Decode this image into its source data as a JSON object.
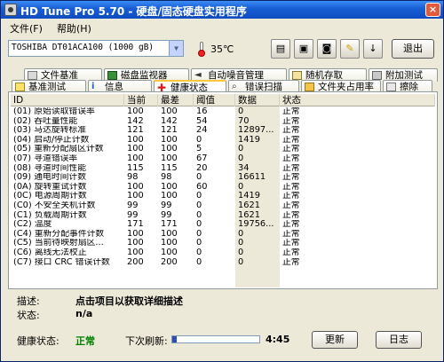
{
  "window": {
    "title": "HD Tune Pro 5.70 - 硬盘/固态硬盘实用程序",
    "close_label": "×"
  },
  "menu": {
    "file": "文件(F)",
    "help": "帮助(H)"
  },
  "toolbar": {
    "drive": "TOSHIBA DT01ACA100 (1000 gB)",
    "temperature": "35℃",
    "exit_label": "退出",
    "buttons": [
      {
        "icon": "copy-info-icon",
        "glyph": "▤"
      },
      {
        "icon": "copy-screen-icon",
        "glyph": "▣"
      },
      {
        "icon": "screenshot-icon",
        "glyph": "◙"
      },
      {
        "icon": "options-icon",
        "glyph": "✎"
      },
      {
        "icon": "download-icon",
        "glyph": "↓"
      }
    ]
  },
  "tabs_top": [
    "文件基准",
    "磁盘监视器",
    "自动噪音管理",
    "随机存取",
    "附加测试"
  ],
  "tabs_bottom": [
    "基准测试",
    "信息",
    "健康状态",
    "错误扫描",
    "文件夹占用率",
    "擦除"
  ],
  "table": {
    "headers": [
      "ID",
      "当前",
      "最差",
      "阈值",
      "数据",
      "状态"
    ],
    "rows": [
      [
        "(01) 原始读取错误率",
        "100",
        "100",
        "16",
        "0",
        "正常"
      ],
      [
        "(02) 吞吐量性能",
        "142",
        "142",
        "54",
        "70",
        "正常"
      ],
      [
        "(03) 马达旋转标准",
        "121",
        "121",
        "24",
        "12897...",
        "正常"
      ],
      [
        "(04) 启动/停止计数",
        "100",
        "100",
        "0",
        "1419",
        "正常"
      ],
      [
        "(05) 重新分配扇区计数",
        "100",
        "100",
        "5",
        "0",
        "正常"
      ],
      [
        "(07) 寻道错误率",
        "100",
        "100",
        "67",
        "0",
        "正常"
      ],
      [
        "(08) 寻道时间性能",
        "115",
        "115",
        "20",
        "34",
        "正常"
      ],
      [
        "(09) 通电时间计数",
        "98",
        "98",
        "0",
        "16611",
        "正常"
      ],
      [
        "(0A) 旋转重试计数",
        "100",
        "100",
        "60",
        "0",
        "正常"
      ],
      [
        "(0C) 电源周期计数",
        "100",
        "100",
        "0",
        "1419",
        "正常"
      ],
      [
        "(C0) 不安全关机计数",
        "99",
        "99",
        "0",
        "1621",
        "正常"
      ],
      [
        "(C1) 负载周期计数",
        "99",
        "99",
        "0",
        "1621",
        "正常"
      ],
      [
        "(C2) 温度",
        "171",
        "171",
        "0",
        "19756...",
        "正常"
      ],
      [
        "(C4) 重新分配事件计数",
        "100",
        "100",
        "0",
        "0",
        "正常"
      ],
      [
        "(C5) 当前待映射扇区...",
        "100",
        "100",
        "0",
        "0",
        "正常"
      ],
      [
        "(C6) 离线无法校正",
        "100",
        "100",
        "0",
        "0",
        "正常"
      ],
      [
        "(C7) 接口 CRC 错误计数",
        "200",
        "200",
        "0",
        "0",
        "正常"
      ]
    ]
  },
  "details": {
    "desc_label": "描述:",
    "desc_value": "点击项目以获取详细描述",
    "state_label": "状态:",
    "state_value": "n/a"
  },
  "status": {
    "health_label": "健康状态:",
    "health_value": "正常",
    "health_color": "#008000",
    "refresh_label": "下次刷新:",
    "refresh_progress": 0.05,
    "countdown": "4:45",
    "refresh_button": "更新",
    "log_button": "日志"
  }
}
